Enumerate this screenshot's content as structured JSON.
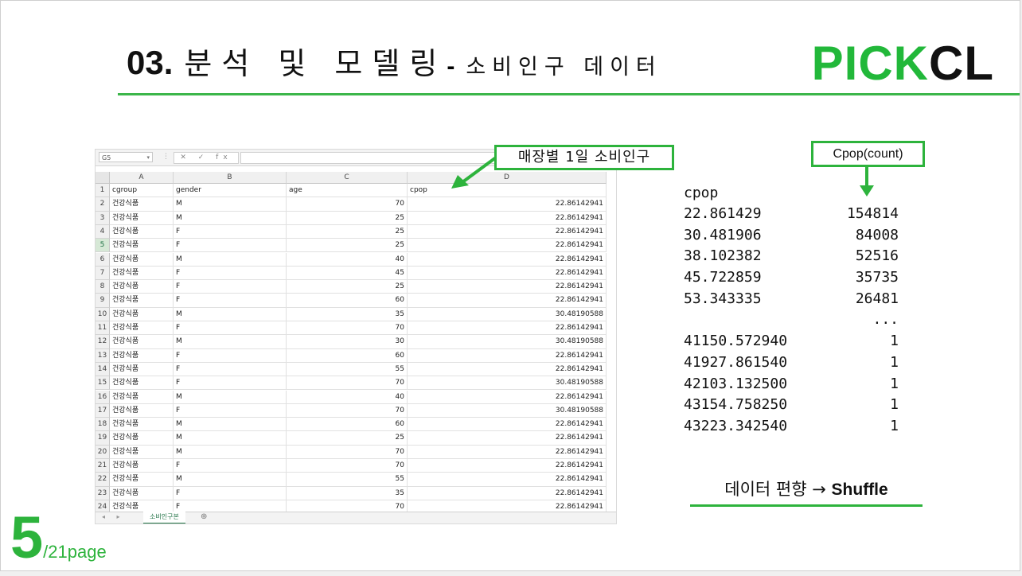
{
  "slide": {
    "title_number": "03.",
    "title_text": "분석 및 모델링",
    "title_dash": "-",
    "title_sub": "소비인구 데이터",
    "brand_green": "PICK",
    "brand_black": "CL",
    "page_current": "5",
    "page_total": "/21page",
    "accent_color": "#2db33c"
  },
  "spreadsheet": {
    "name_box": "G5",
    "formula_icons": "✕ ✓ fx",
    "column_letters": [
      "A",
      "B",
      "C",
      "D"
    ],
    "headers": [
      "cgroup",
      "gender",
      "age",
      "cpop"
    ],
    "rows": [
      [
        "건강식품",
        "M",
        "70",
        "22.86142941"
      ],
      [
        "건강식품",
        "M",
        "25",
        "22.86142941"
      ],
      [
        "건강식품",
        "F",
        "25",
        "22.86142941"
      ],
      [
        "건강식품",
        "F",
        "25",
        "22.86142941"
      ],
      [
        "건강식품",
        "M",
        "40",
        "22.86142941"
      ],
      [
        "건강식품",
        "F",
        "45",
        "22.86142941"
      ],
      [
        "건강식품",
        "F",
        "25",
        "22.86142941"
      ],
      [
        "건강식품",
        "F",
        "60",
        "22.86142941"
      ],
      [
        "건강식품",
        "M",
        "35",
        "30.48190588"
      ],
      [
        "건강식품",
        "F",
        "70",
        "22.86142941"
      ],
      [
        "건강식품",
        "M",
        "30",
        "30.48190588"
      ],
      [
        "건강식품",
        "F",
        "60",
        "22.86142941"
      ],
      [
        "건강식품",
        "F",
        "55",
        "22.86142941"
      ],
      [
        "건강식품",
        "F",
        "70",
        "30.48190588"
      ],
      [
        "건강식품",
        "M",
        "40",
        "22.86142941"
      ],
      [
        "건강식품",
        "F",
        "70",
        "30.48190588"
      ],
      [
        "건강식품",
        "M",
        "60",
        "22.86142941"
      ],
      [
        "건강식품",
        "M",
        "25",
        "22.86142941"
      ],
      [
        "건강식품",
        "M",
        "70",
        "22.86142941"
      ],
      [
        "건강식품",
        "F",
        "70",
        "22.86142941"
      ],
      [
        "건강식품",
        "M",
        "55",
        "22.86142941"
      ],
      [
        "건강식품",
        "F",
        "35",
        "22.86142941"
      ],
      [
        "건강식품",
        "F",
        "70",
        "22.86142941"
      ]
    ],
    "sheet_tab": "소비인구본",
    "add_sheet": "⊕",
    "nav_arrows": "◂ ▸"
  },
  "callouts": {
    "daily_pop": "매장별 1일 소비인구",
    "count": "Cpop(count)"
  },
  "value_counts": {
    "header": "cpop",
    "top": [
      {
        "value": "22.861429",
        "count": "154814"
      },
      {
        "value": "30.481906",
        "count": "84008"
      },
      {
        "value": "38.102382",
        "count": "52516"
      },
      {
        "value": "45.722859",
        "count": "35735"
      },
      {
        "value": "53.343335",
        "count": "26481"
      }
    ],
    "ellipsis": "...",
    "bottom": [
      {
        "value": "41150.572940",
        "count": "1"
      },
      {
        "value": "41927.861540",
        "count": "1"
      },
      {
        "value": "42103.132500",
        "count": "1"
      },
      {
        "value": "43154.758250",
        "count": "1"
      },
      {
        "value": "43223.342540",
        "count": "1"
      }
    ]
  },
  "note": {
    "text": "데이터 편향 → ",
    "bold": "Shuffle"
  }
}
